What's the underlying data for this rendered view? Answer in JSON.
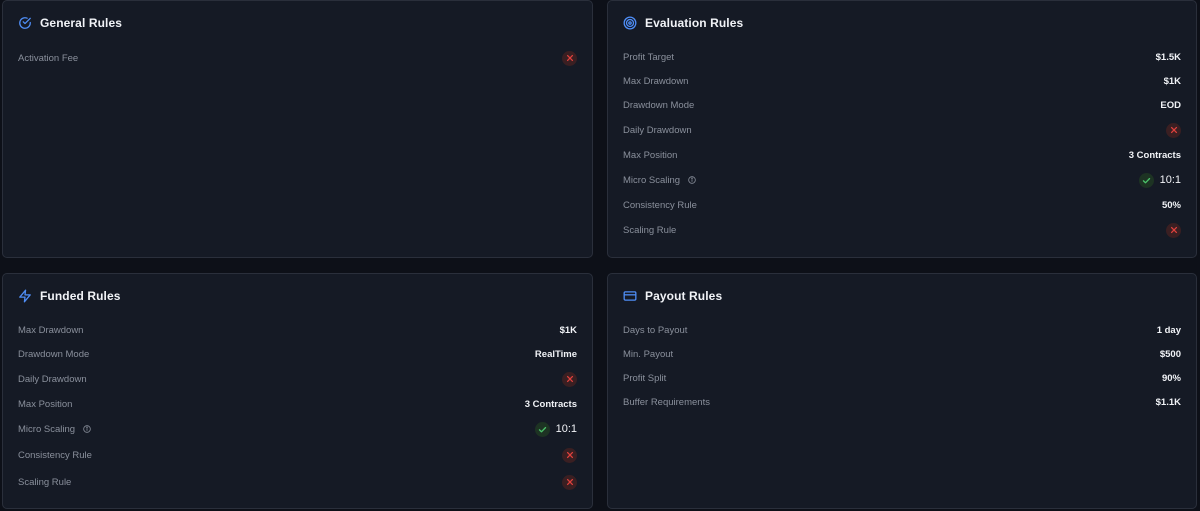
{
  "general": {
    "title": "General Rules",
    "rows": [
      {
        "label": "Activation Fee",
        "type": "x"
      }
    ]
  },
  "evaluation": {
    "title": "Evaluation Rules",
    "rows": [
      {
        "label": "Profit Target",
        "type": "text",
        "value": "$1.5K"
      },
      {
        "label": "Max Drawdown",
        "type": "text",
        "value": "$1K"
      },
      {
        "label": "Drawdown Mode",
        "type": "text",
        "value": "EOD"
      },
      {
        "label": "Daily Drawdown",
        "type": "x"
      },
      {
        "label": "Max Position",
        "type": "text",
        "value": "3 Contracts"
      },
      {
        "label": "Micro Scaling",
        "type": "check",
        "value": "10:1",
        "info": true
      },
      {
        "label": "Consistency Rule",
        "type": "text",
        "value": "50%"
      },
      {
        "label": "Scaling Rule",
        "type": "x"
      }
    ]
  },
  "funded": {
    "title": "Funded Rules",
    "rows": [
      {
        "label": "Max Drawdown",
        "type": "text",
        "value": "$1K"
      },
      {
        "label": "Drawdown Mode",
        "type": "text",
        "value": "RealTime"
      },
      {
        "label": "Daily Drawdown",
        "type": "x"
      },
      {
        "label": "Max Position",
        "type": "text",
        "value": "3 Contracts"
      },
      {
        "label": "Micro Scaling",
        "type": "check",
        "value": "10:1",
        "info": true
      },
      {
        "label": "Consistency Rule",
        "type": "x"
      },
      {
        "label": "Scaling Rule",
        "type": "x"
      }
    ]
  },
  "payout": {
    "title": "Payout Rules",
    "rows": [
      {
        "label": "Days to Payout",
        "type": "text",
        "value": "1 day"
      },
      {
        "label": "Min. Payout",
        "type": "text",
        "value": "$500"
      },
      {
        "label": "Profit Split",
        "type": "text",
        "value": "90%"
      },
      {
        "label": "Buffer Requirements",
        "type": "text",
        "value": "$1.1K"
      }
    ]
  },
  "colors": {
    "accent": "#4f8ef7",
    "x_icon": "#e0413d",
    "check_icon": "#4bc26a"
  },
  "icons": {
    "general": "check-circle-icon",
    "evaluation": "target-icon",
    "funded": "lightning-icon",
    "payout": "credit-card-icon"
  }
}
